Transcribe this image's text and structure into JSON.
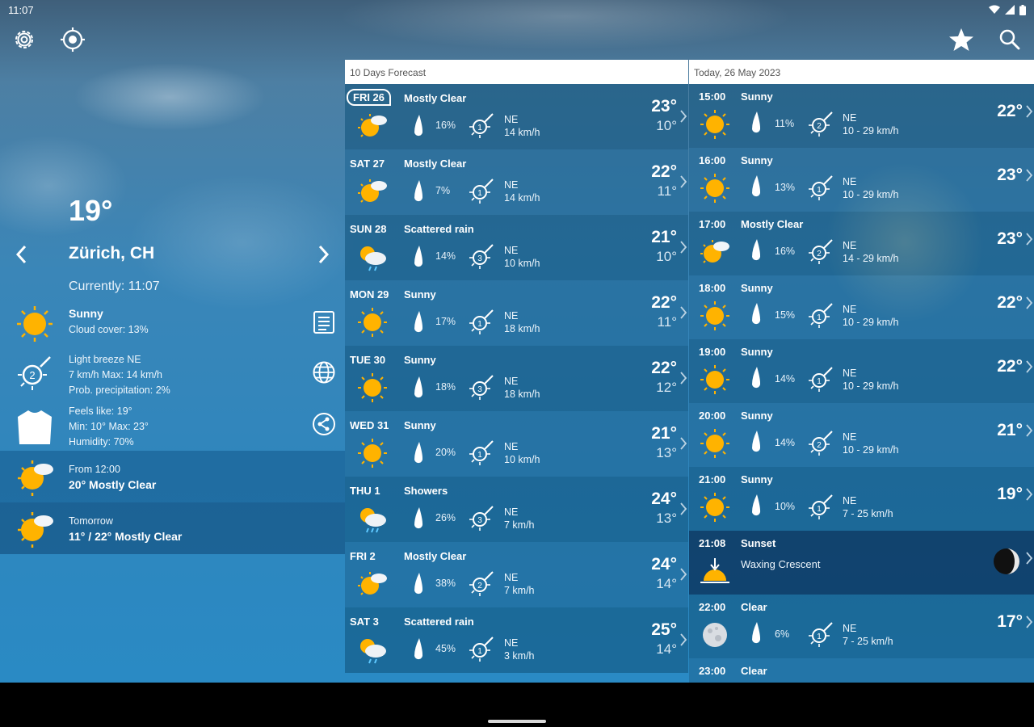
{
  "status_bar": {
    "time": "11:07"
  },
  "toolbar": {
    "settings": "gear-icon",
    "location": "target-icon",
    "favorite": "star-icon",
    "search": "search-icon"
  },
  "current": {
    "temperature": "19°",
    "city": "Zürich, CH",
    "currently": "Currently: 11:07",
    "condition": "Sunny",
    "cloud_cover": "Cloud cover: 13%",
    "wind_line1": "Light breeze NE",
    "wind_line2": "7 km/h Max: 14 km/h",
    "wind_line3": "Prob. precipitation: 2%",
    "feels_like": "Feels like: 19°",
    "min_max": "Min: 10° Max: 23°",
    "humidity": "Humidity: 70%",
    "wind_force": "2"
  },
  "summaries": [
    {
      "line1": "From 12:00",
      "line2": "20° Mostly Clear"
    },
    {
      "line1": "Tomorrow",
      "line2": "11° / 22° Mostly Clear"
    }
  ],
  "days_header": "10 Days Forecast",
  "days": [
    {
      "day": "FRI 26",
      "cond": "Mostly Clear",
      "icon": "partly-cloudy-icon",
      "pct": "16%",
      "wind_force": "1",
      "dir": "NE",
      "speed": "14 km/h",
      "max": "23°",
      "min": "10°"
    },
    {
      "day": "SAT 27",
      "cond": "Mostly Clear",
      "icon": "partly-cloudy-icon",
      "pct": "7%",
      "wind_force": "1",
      "dir": "NE",
      "speed": "14 km/h",
      "max": "22°",
      "min": "11°"
    },
    {
      "day": "SUN 28",
      "cond": "Scattered rain",
      "icon": "rain-icon",
      "pct": "14%",
      "wind_force": "3",
      "dir": "NE",
      "speed": "10 km/h",
      "max": "21°",
      "min": "10°"
    },
    {
      "day": "MON 29",
      "cond": "Sunny",
      "icon": "sun-icon",
      "pct": "17%",
      "wind_force": "1",
      "dir": "NE",
      "speed": "18 km/h",
      "max": "22°",
      "min": "11°"
    },
    {
      "day": "TUE 30",
      "cond": "Sunny",
      "icon": "sun-icon",
      "pct": "18%",
      "wind_force": "3",
      "dir": "NE",
      "speed": "18 km/h",
      "max": "22°",
      "min": "12°"
    },
    {
      "day": "WED 31",
      "cond": "Sunny",
      "icon": "sun-icon",
      "pct": "20%",
      "wind_force": "1",
      "dir": "NE",
      "speed": "10 km/h",
      "max": "21°",
      "min": "13°"
    },
    {
      "day": "THU 1",
      "cond": "Showers",
      "icon": "showers-icon",
      "pct": "26%",
      "wind_force": "3",
      "dir": "NE",
      "speed": "7 km/h",
      "max": "24°",
      "min": "13°"
    },
    {
      "day": "FRI 2",
      "cond": "Mostly Clear",
      "icon": "partly-cloudy-icon",
      "pct": "38%",
      "wind_force": "2",
      "dir": "NE",
      "speed": "7 km/h",
      "max": "24°",
      "min": "14°"
    },
    {
      "day": "SAT 3",
      "cond": "Scattered rain",
      "icon": "rain-icon",
      "pct": "45%",
      "wind_force": "1",
      "dir": "NE",
      "speed": "3 km/h",
      "max": "25°",
      "min": "14°"
    }
  ],
  "hours_header": "Today, 26 May 2023",
  "hours": [
    {
      "time": "15:00",
      "cond": "Sunny",
      "icon": "sun-icon",
      "pct": "11%",
      "wind_force": "2",
      "dir": "NE",
      "speed": "10 - 29 km/h",
      "temp": "22°"
    },
    {
      "time": "16:00",
      "cond": "Sunny",
      "icon": "sun-icon",
      "pct": "13%",
      "wind_force": "1",
      "dir": "NE",
      "speed": "10 - 29 km/h",
      "temp": "23°"
    },
    {
      "time": "17:00",
      "cond": "Mostly Clear",
      "icon": "partly-cloudy-icon",
      "pct": "16%",
      "wind_force": "2",
      "dir": "NE",
      "speed": "14 - 29 km/h",
      "temp": "23°"
    },
    {
      "time": "18:00",
      "cond": "Sunny",
      "icon": "sun-icon",
      "pct": "15%",
      "wind_force": "1",
      "dir": "NE",
      "speed": "10 - 29 km/h",
      "temp": "22°"
    },
    {
      "time": "19:00",
      "cond": "Sunny",
      "icon": "sun-icon",
      "pct": "14%",
      "wind_force": "1",
      "dir": "NE",
      "speed": "10 - 29 km/h",
      "temp": "22°"
    },
    {
      "time": "20:00",
      "cond": "Sunny",
      "icon": "sun-icon",
      "pct": "14%",
      "wind_force": "2",
      "dir": "NE",
      "speed": "10 - 29 km/h",
      "temp": "21°"
    },
    {
      "time": "21:00",
      "cond": "Sunny",
      "icon": "sun-icon",
      "pct": "10%",
      "wind_force": "1",
      "dir": "NE",
      "speed": "7 - 25 km/h",
      "temp": "19°"
    },
    {
      "time": "21:08",
      "cond": "Sunset",
      "phase": "Waxing Crescent",
      "icon": "sunset-icon",
      "special": "sunset"
    },
    {
      "time": "22:00",
      "cond": "Clear",
      "icon": "moon-icon",
      "pct": "6%",
      "wind_force": "1",
      "dir": "NE",
      "speed": "7 - 25 km/h",
      "temp": "17°"
    },
    {
      "time": "23:00",
      "cond": "Clear",
      "icon": "moon-icon",
      "pct": "",
      "wind_force": "",
      "dir": "",
      "speed": "",
      "temp": ""
    }
  ],
  "colors": {
    "sun": "#ffb300",
    "accent_white": "#ffffff",
    "header_bg": "#ffffff"
  }
}
